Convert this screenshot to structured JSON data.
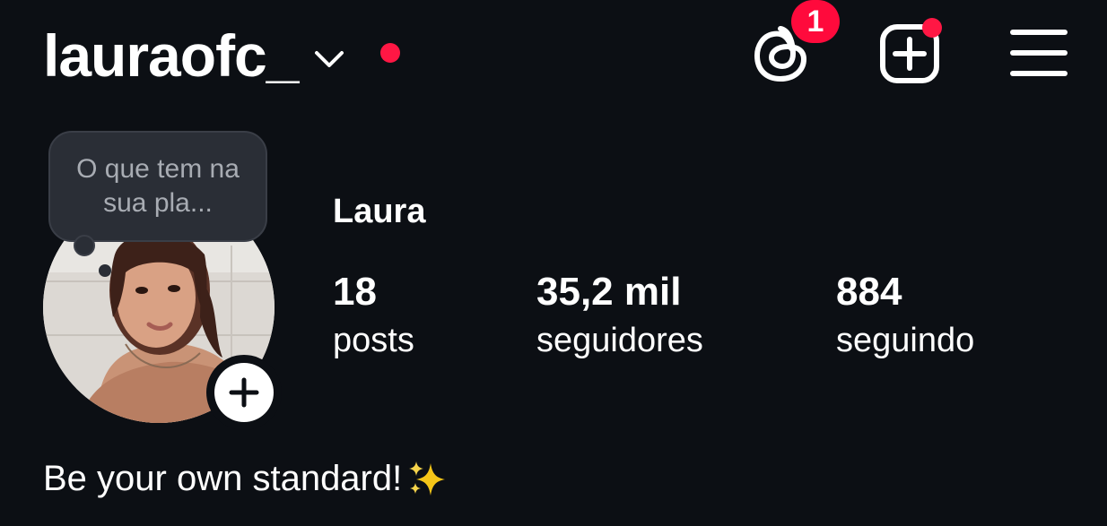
{
  "header": {
    "username": "lauraofc_",
    "chevron_icon": "chevron-down-icon",
    "account_dot_color": "#ff1744",
    "threads": {
      "icon": "threads-icon",
      "badge_count": "1",
      "badge_color": "#ff0a3c"
    },
    "create": {
      "icon": "create-post-icon",
      "dot_color": "#ff1744"
    },
    "menu_icon": "hamburger-menu-icon"
  },
  "profile": {
    "note": "O que tem na sua pla...",
    "display_name": "Laura",
    "avatar": "profile-photo",
    "add_story_icon": "plus-icon",
    "stats": [
      {
        "value": "18",
        "label": "posts"
      },
      {
        "value": "35,2 mil",
        "label": "seguidores"
      },
      {
        "value": "884",
        "label": "seguindo"
      }
    ],
    "bio": "Be your own standard!",
    "bio_emoji": "sparkles-icon"
  },
  "colors": {
    "background": "#0c0f14",
    "text": "#ffffff",
    "note_bubble": "#2a2e36",
    "note_text": "#a8acb3"
  }
}
